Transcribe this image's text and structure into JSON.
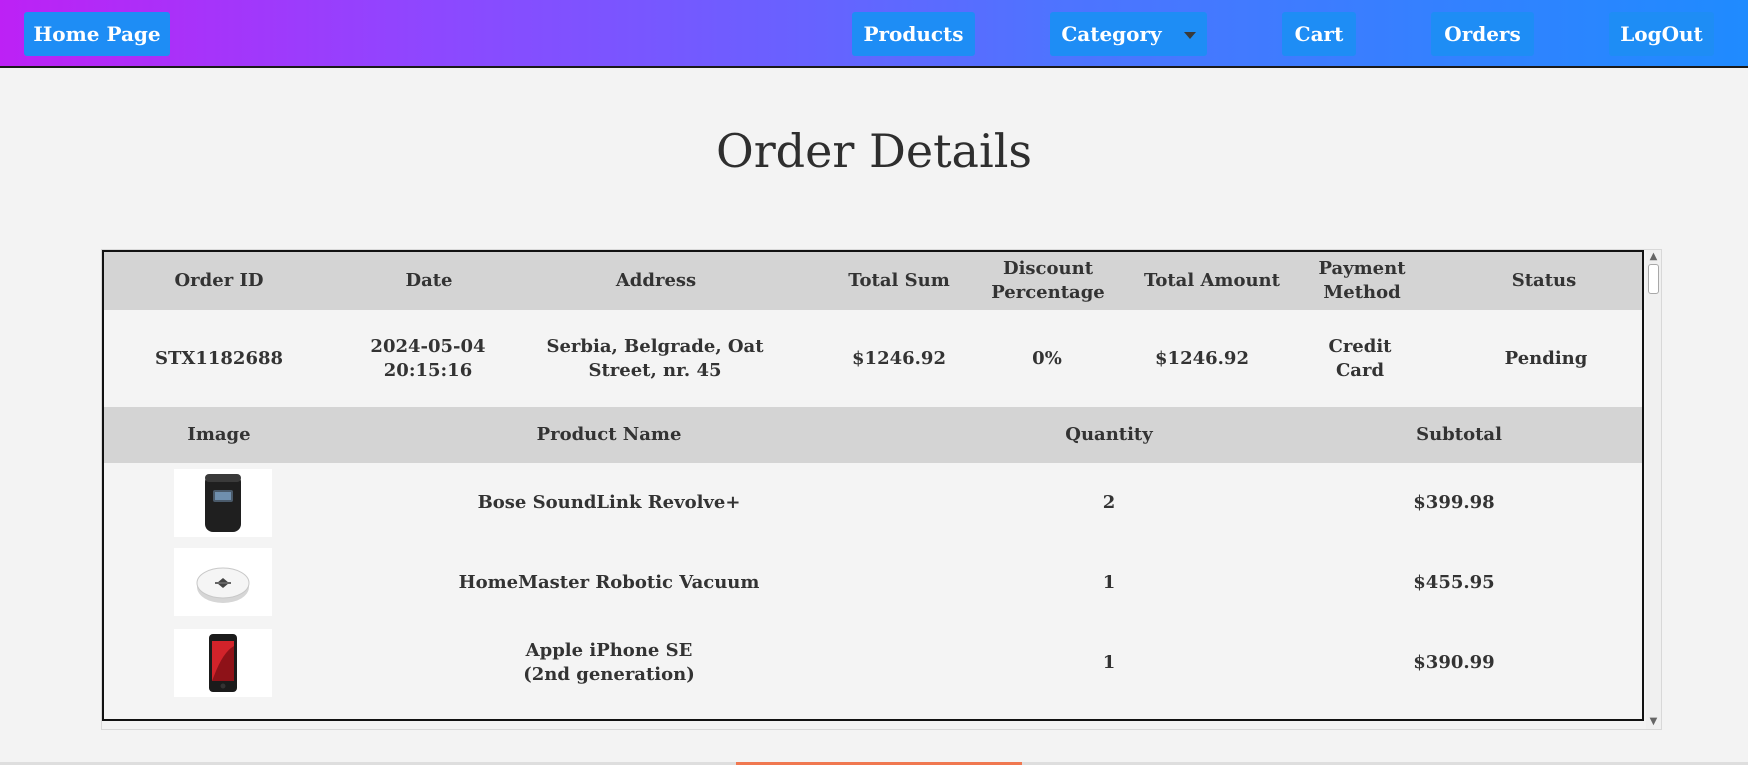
{
  "nav": {
    "home": "Home Page",
    "products": "Products",
    "category": "Category",
    "cart": "Cart",
    "orders": "Orders",
    "logout": "LogOut"
  },
  "page": {
    "title": "Order Details"
  },
  "order": {
    "headers": [
      "Order ID",
      "Date",
      "Address",
      "Total Sum",
      "Discount Percentage",
      "Total Amount",
      "Payment Method",
      "Status"
    ],
    "values": {
      "order_id": "STX1182688",
      "date": "2024-05-04 20:15:16",
      "address": "Serbia, Belgrade, Oat Street, nr. 45",
      "total_sum": "$1246.92",
      "discount": "0%",
      "total_amount": "$1246.92",
      "payment_method": "Credit Card",
      "status": "Pending"
    }
  },
  "items": {
    "headers": [
      "Image",
      "Product Name",
      "Quantity",
      "Subtotal"
    ],
    "rows": [
      {
        "name": "Bose SoundLink Revolve+",
        "quantity": "2",
        "subtotal": "$399.98",
        "icon": "speaker-image"
      },
      {
        "name": "HomeMaster Robotic Vacuum",
        "quantity": "1",
        "subtotal": "$455.95",
        "icon": "robot-vacuum-image"
      },
      {
        "name": "Apple iPhone SE (2nd generation)",
        "quantity": "1",
        "subtotal": "$390.99",
        "icon": "iphone-image"
      }
    ]
  },
  "colors": {
    "nav_gradient_start": "#bd21f5",
    "nav_gradient_end": "#1f8bff",
    "nav_button": "#1e8df5",
    "table_header": "#d4d4d4",
    "footer_accent": "#f07850"
  }
}
